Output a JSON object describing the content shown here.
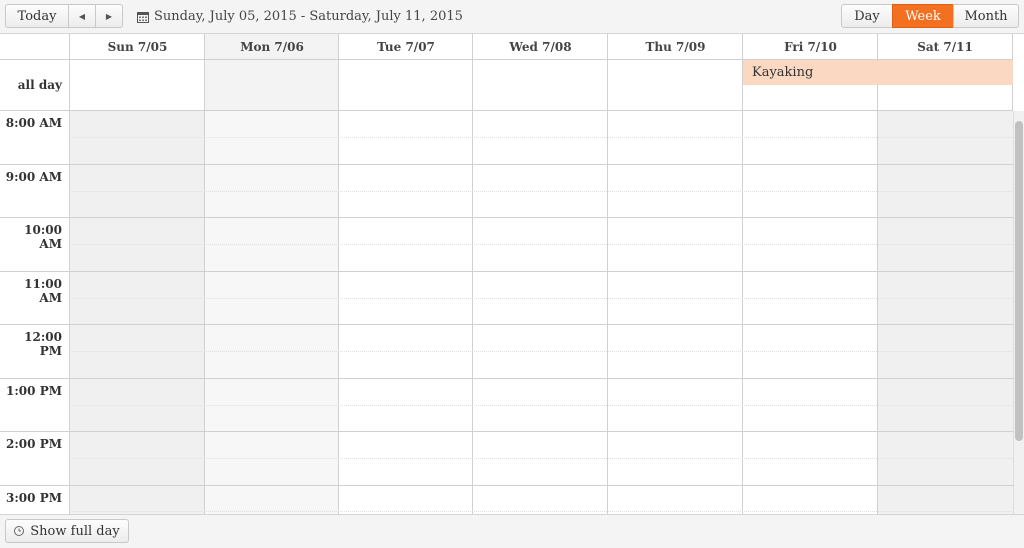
{
  "toolbar": {
    "today_label": "Today",
    "prev_icon": "triangle-left",
    "next_icon": "triangle-right",
    "range_icon": "calendar-icon",
    "date_range": "Sunday, July 05, 2015 - Saturday, July 11, 2015",
    "views": {
      "day": "Day",
      "week": "Week",
      "month": "Month"
    },
    "active_view": "Week",
    "accent_color": "#f37021"
  },
  "days": [
    {
      "label": "Sun 7/05",
      "weekend": true
    },
    {
      "label": "Mon 7/06",
      "weekend": false,
      "today": true
    },
    {
      "label": "Tue 7/07",
      "weekend": false
    },
    {
      "label": "Wed 7/08",
      "weekend": false
    },
    {
      "label": "Thu 7/09",
      "weekend": false
    },
    {
      "label": "Fri 7/10",
      "weekend": false
    },
    {
      "label": "Sat 7/11",
      "weekend": true
    }
  ],
  "allday_label": "all day",
  "events": [
    {
      "title": "Kayaking",
      "start_day": "Fri 7/10",
      "end_day": "Sat 7/11",
      "all_day": true,
      "color": "#fbd8c2"
    }
  ],
  "times": [
    "8:00 AM",
    "9:00 AM",
    "10:00 AM",
    "11:00 AM",
    "12:00 PM",
    "1:00 PM",
    "2:00 PM",
    "3:00 PM"
  ],
  "footer": {
    "show_full_day_label": "Show full day",
    "icon": "clock-icon"
  }
}
